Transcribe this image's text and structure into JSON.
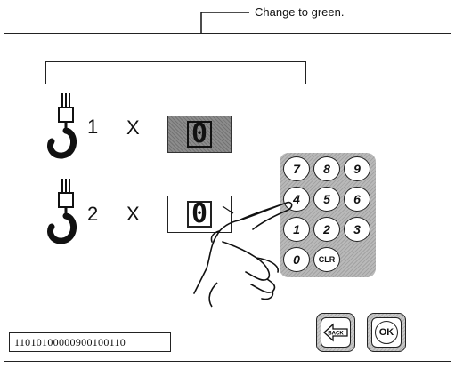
{
  "annotation": {
    "text": "Change to green."
  },
  "rows": [
    {
      "hook_number": "1",
      "multiply": "X",
      "value": "0"
    },
    {
      "hook_number": "2",
      "multiply": "X",
      "value": "0"
    }
  ],
  "keypad": {
    "keys": [
      "7",
      "8",
      "9",
      "4",
      "5",
      "6",
      "1",
      "2",
      "3",
      "0",
      "CLR"
    ]
  },
  "status": {
    "code": "11010100000900100110"
  },
  "buttons": {
    "back_label": "BACK",
    "ok_label": "OK"
  }
}
